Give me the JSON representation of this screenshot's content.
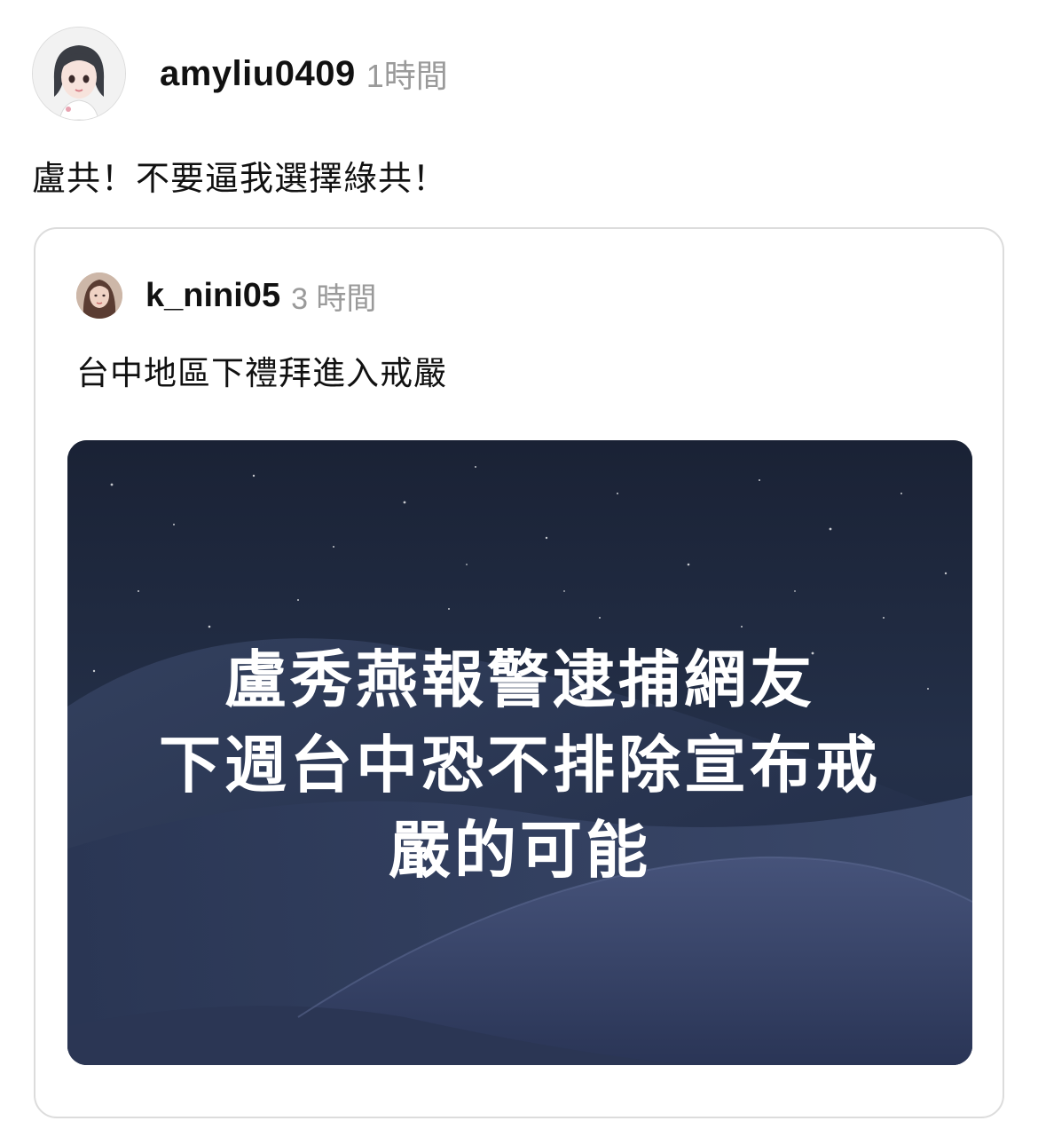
{
  "post": {
    "author": "amyliu0409",
    "time": "1時間",
    "text": "盧共！不要逼我選擇綠共！",
    "avatar_icon": "anime-girl-avatar-icon"
  },
  "quoted_post": {
    "author": "k_nini05",
    "time": "3 時間",
    "text": "台中地區下禮拜進入戒嚴",
    "avatar_icon": "profile-photo-icon",
    "image": {
      "headline_lines": [
        "盧秀燕報警逮捕網友",
        "下週台中恐不排除宣布戒",
        "嚴的可能"
      ]
    }
  },
  "colors": {
    "username": "#111111",
    "timestamp": "#9a9a9a",
    "card_border": "#dcdcdc",
    "image_bg": "#1b2439"
  }
}
